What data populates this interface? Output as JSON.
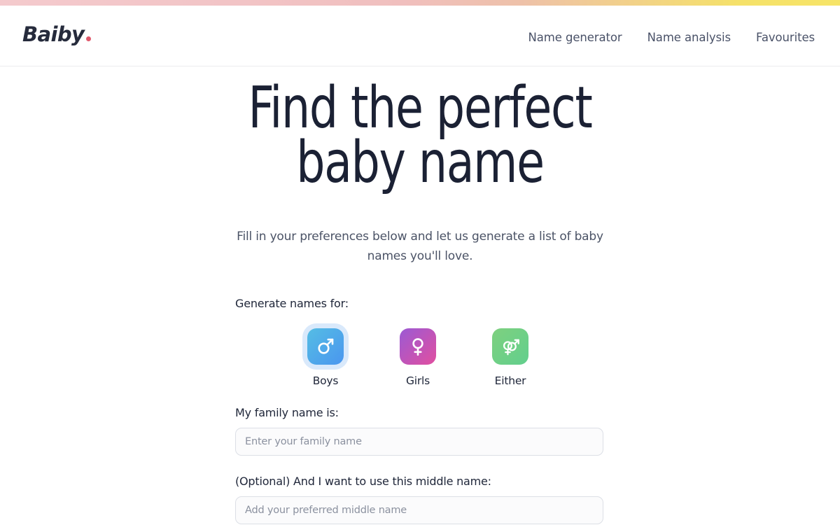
{
  "theme": {
    "gradient_start": "#f4cacd",
    "gradient_end": "#f5e169",
    "text_dark": "#1b2134",
    "text_muted": "#4b5366",
    "accent_dot": "#e0596c",
    "selection_ring": "#d9e9fb"
  },
  "header": {
    "brand": {
      "word": "Baiby",
      "dot": "."
    },
    "nav": [
      {
        "label": "Name generator"
      },
      {
        "label": "Name analysis"
      },
      {
        "label": "Favourites"
      }
    ]
  },
  "hero": {
    "title": "Find the perfect baby name",
    "subtitle": "Fill in your preferences below and let us generate a list of baby names you'll love."
  },
  "form": {
    "gender": {
      "label": "Generate names for:",
      "options": [
        {
          "label": "Boys",
          "icon": "male-symbol-icon",
          "selected": true,
          "gradient": [
            "#55bde4",
            "#4a96ef"
          ]
        },
        {
          "label": "Girls",
          "icon": "female-symbol-icon",
          "selected": false,
          "gradient": [
            "#9b5ad4",
            "#e14fa0"
          ]
        },
        {
          "label": "Either",
          "icon": "both-genders-icon",
          "selected": false,
          "gradient": [
            "#7ed07f",
            "#62cf8d"
          ]
        }
      ]
    },
    "family_name": {
      "label": "My family name is:",
      "placeholder": "Enter your family name",
      "value": ""
    },
    "middle_name": {
      "label": "(Optional) And I want to use this middle name:",
      "placeholder": "Add your preferred middle name",
      "value": ""
    }
  }
}
